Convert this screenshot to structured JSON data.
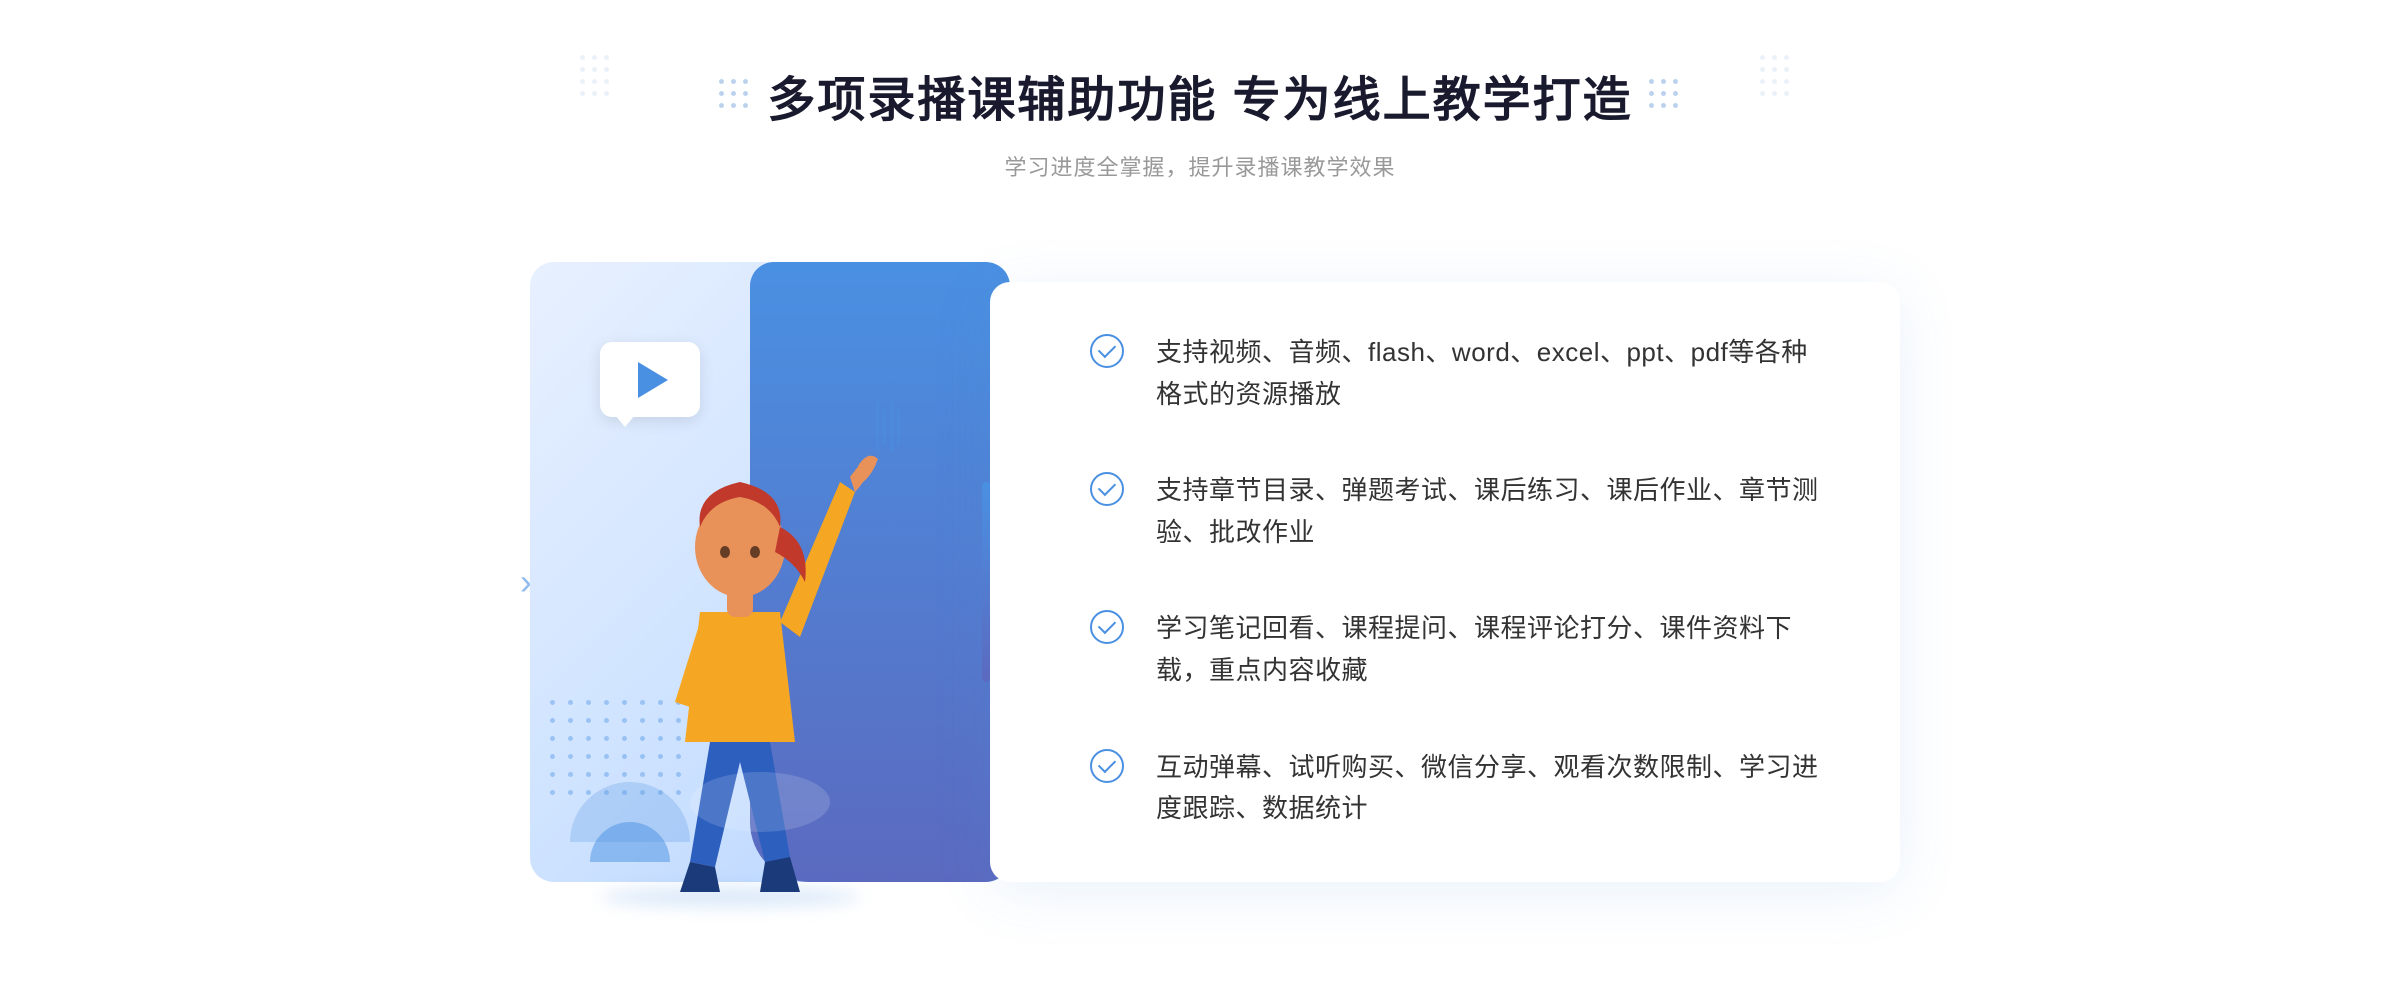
{
  "header": {
    "title": "多项录播课辅助功能 专为线上教学打造",
    "subtitle": "学习进度全掌握，提升录播课教学效果"
  },
  "features": [
    {
      "id": "feature-1",
      "text": "支持视频、音频、flash、word、excel、ppt、pdf等各种格式的资源播放"
    },
    {
      "id": "feature-2",
      "text": "支持章节目录、弹题考试、课后练习、课后作业、章节测验、批改作业"
    },
    {
      "id": "feature-3",
      "text": "学习笔记回看、课程提问、课程评论打分、课件资料下载，重点内容收藏"
    },
    {
      "id": "feature-4",
      "text": "互动弹幕、试听购买、微信分享、观看次数限制、学习进度跟踪、数据统计"
    }
  ],
  "colors": {
    "primary": "#4a90e2",
    "secondary": "#5b6abf",
    "text_dark": "#1a1a2e",
    "text_medium": "#333333",
    "text_light": "#999999"
  }
}
